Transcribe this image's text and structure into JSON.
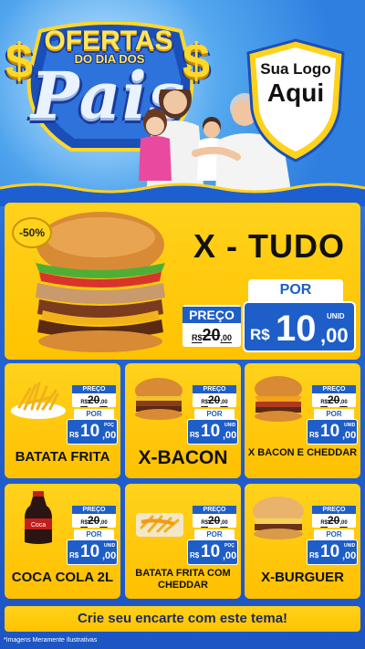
{
  "header": {
    "title_top": "OFERTAS",
    "title_mid": "DO DIA DOS",
    "title_big": "Pais",
    "dollar_sign": "$",
    "logo_line1": "Sua Logo",
    "logo_line2": "Aqui"
  },
  "hero": {
    "discount": "-50%",
    "name": "X - TUDO",
    "preco_label": "PREÇO",
    "old_currency": "R$",
    "old_int": "20",
    "old_dec": ",00",
    "por_label": "POR",
    "currency": "R$",
    "price_int": "10",
    "price_dec": ",00",
    "unit": "UNID"
  },
  "products": [
    {
      "name": "BATATA FRITA",
      "preco_label": "PREÇO",
      "old_currency": "R$",
      "old_int": "20",
      "old_dec": ",00",
      "por_label": "POR",
      "currency": "R$",
      "price_int": "10",
      "price_dec": ",00",
      "unit": "POÇ",
      "image": "fries-icon"
    },
    {
      "name": "X-BACON",
      "preco_label": "PREÇO",
      "old_currency": "R$",
      "old_int": "20",
      "old_dec": ",00",
      "por_label": "POR",
      "currency": "R$",
      "price_int": "10",
      "price_dec": ",00",
      "unit": "UNID",
      "image": "burger-icon"
    },
    {
      "name": "X BACON E CHEDDAR",
      "preco_label": "PREÇO",
      "old_currency": "R$",
      "old_int": "20",
      "old_dec": ",00",
      "por_label": "POR",
      "currency": "R$",
      "price_int": "10",
      "price_dec": ",00",
      "unit": "UNID",
      "image": "cheddar-burger-icon"
    },
    {
      "name": "COCA COLA 2L",
      "preco_label": "PREÇO",
      "old_currency": "R$",
      "old_int": "20",
      "old_dec": ",00",
      "por_label": "POR",
      "currency": "R$",
      "price_int": "10",
      "price_dec": ",00",
      "unit": "UNID",
      "image": "soda-bottle-icon"
    },
    {
      "name": "BATATA FRITA COM CHEDDAR",
      "preco_label": "PREÇO",
      "old_currency": "R$",
      "old_int": "20",
      "old_dec": ",00",
      "por_label": "POR",
      "currency": "R$",
      "price_int": "10",
      "price_dec": ",00",
      "unit": "POÇ",
      "image": "cheddar-fries-icon"
    },
    {
      "name": "X-BURGUER",
      "preco_label": "PREÇO",
      "old_currency": "R$",
      "old_int": "20",
      "old_dec": ",00",
      "por_label": "POR",
      "currency": "R$",
      "price_int": "10",
      "price_dec": ",00",
      "unit": "UNID",
      "image": "cheeseburger-icon"
    }
  ],
  "cta": "Crie seu encarte com este tema!",
  "footnote": "*Imagens Meramente Ilustrativas",
  "colors": {
    "accent_yellow": "#ffc300",
    "brand_blue": "#1e5ec9",
    "background_blue": "#2466d6"
  }
}
